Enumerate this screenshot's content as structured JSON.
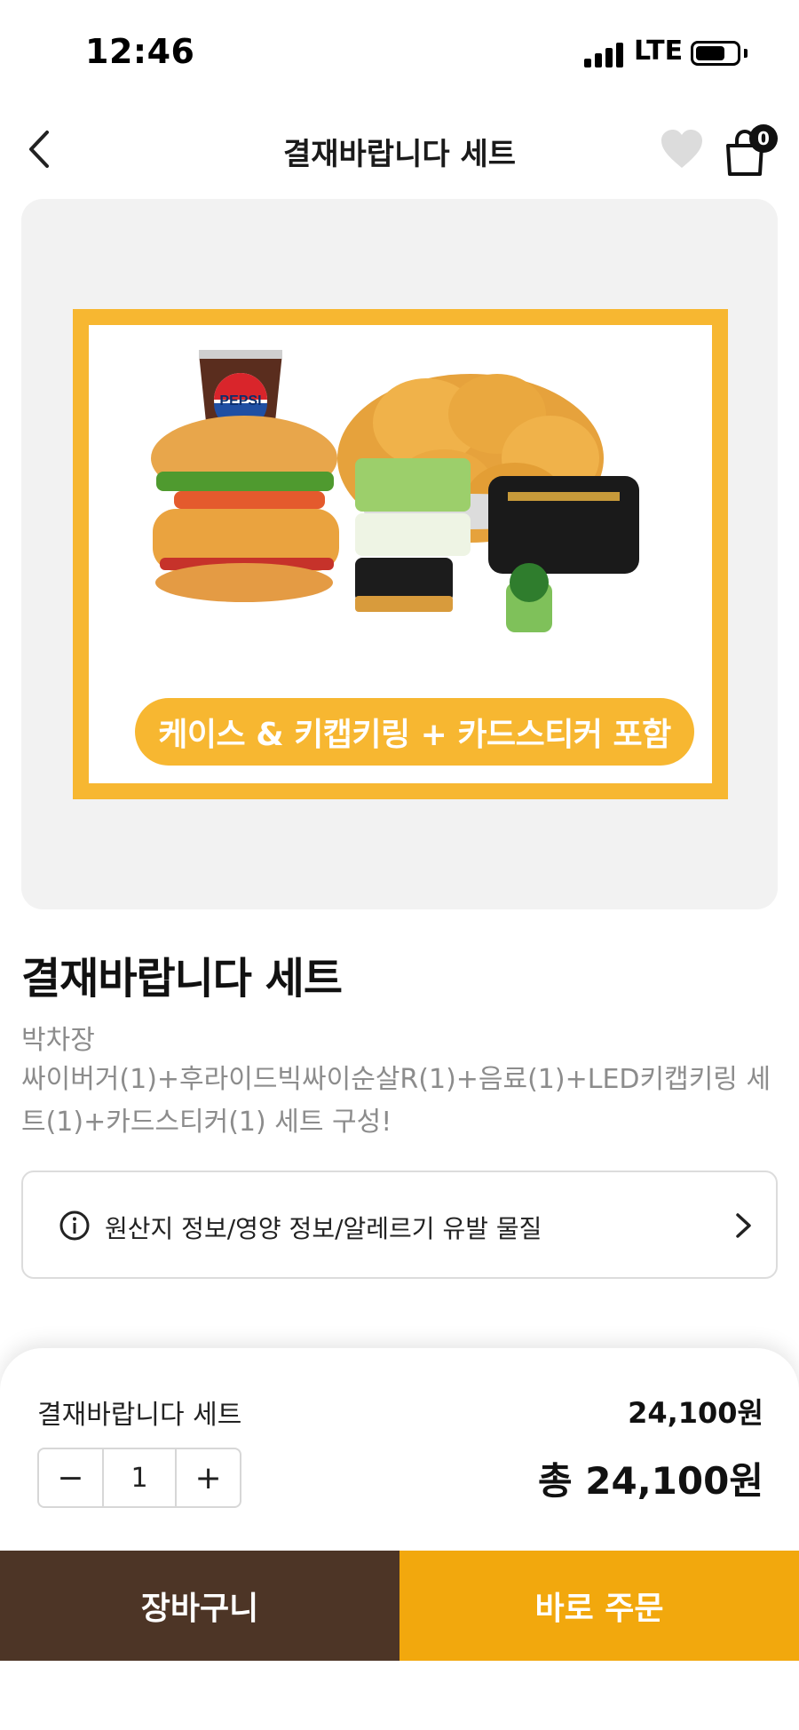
{
  "status_bar": {
    "time": "12:46",
    "network": "LTE"
  },
  "header": {
    "title": "결재바랍니다 세트",
    "cart_count": "0"
  },
  "promo": {
    "banner_text": "케이스 & 키캡키링 + 카드스티커 포함",
    "drink_label": "PEPSI"
  },
  "product": {
    "name": "결재바랍니다 세트",
    "sub": "박차장",
    "description": "싸이버거(1)+후라이드빅싸이순살R(1)+음료(1)+LED키캡키링 세트(1)+카드스티커(1) 세트 구성!"
  },
  "info_link": {
    "label": "원산지 정보/영양 정보/알레르기 유발 물질"
  },
  "sheet": {
    "item_name": "결재바랍니다 세트",
    "item_price": "24,100원",
    "quantity": "1",
    "minus": "−",
    "plus": "+",
    "total": "총 24,100원"
  },
  "actions": {
    "cart": "장바구니",
    "order": "바로 주문"
  },
  "colors": {
    "brand_brown": "#4d3526",
    "brand_yellow": "#f2a80d",
    "promo_yellow": "#f7b731"
  }
}
